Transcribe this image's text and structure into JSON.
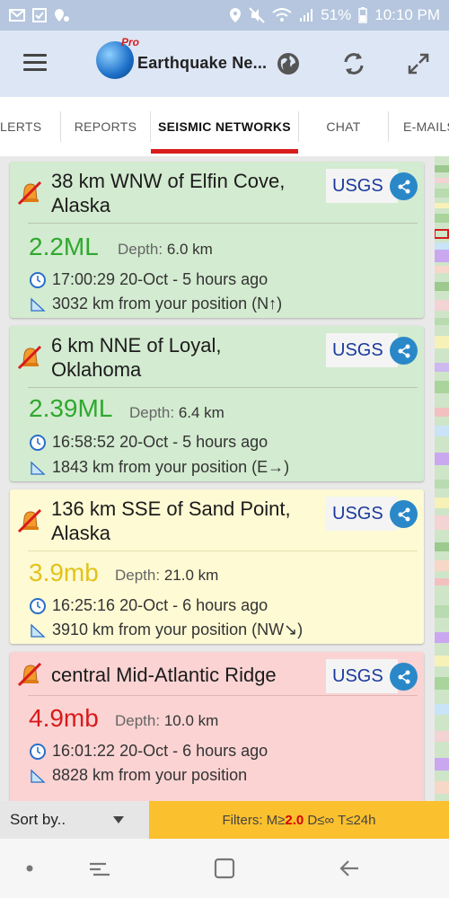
{
  "status_bar": {
    "battery": "51%",
    "time": "10:10 PM"
  },
  "app_bar": {
    "title": "Earthquake Ne...",
    "logo_badge": "Pro"
  },
  "tabs": [
    {
      "label": "LERTS",
      "active": false
    },
    {
      "label": "REPORTS",
      "active": false
    },
    {
      "label": "SEISMIC NETWORKS",
      "active": true
    },
    {
      "label": "CHAT",
      "active": false
    },
    {
      "label": "E-MAILS",
      "active": false
    }
  ],
  "quakes": [
    {
      "place_line1": "38 km WNW of Elfin Cove,",
      "place_line2": "Alaska",
      "network": "USGS",
      "magnitude": "2.2ML",
      "depth_label": "Depth:",
      "depth_value": "6.0 km",
      "time": "17:00:29 20-Oct - 5 hours ago",
      "distance": "3032 km from your position (N↑)",
      "color": "#2fa82f"
    },
    {
      "place_line1": "6 km NNE of Loyal,",
      "place_line2": "Oklahoma",
      "network": "USGS",
      "magnitude": "2.39ML",
      "depth_label": "Depth:",
      "depth_value": "6.4 km",
      "time": "16:58:52 20-Oct - 5 hours ago",
      "distance": "1843 km from your position (E→)",
      "color": "#2fa82f"
    },
    {
      "place_line1": "136 km SSE of Sand Point,",
      "place_line2": "Alaska",
      "network": "USGS",
      "magnitude": "3.9mb",
      "depth_label": "Depth:",
      "depth_value": "21.0 km",
      "time": "16:25:16 20-Oct - 6 hours ago",
      "distance": "3910 km from your position (NW↘)",
      "color": "#e3c21c"
    },
    {
      "place_line1": "central Mid-Atlantic Ridge",
      "place_line2": "",
      "network": "USGS",
      "magnitude": "4.9mb",
      "depth_label": "Depth:",
      "depth_value": "10.0 km",
      "time": "16:01:22 20-Oct - 6 hours ago",
      "distance": "8828 km from your position",
      "color": "#d81b1b"
    }
  ],
  "bottom_bar": {
    "sort_label": "Sort by..",
    "filters_prefix": "Filters: M≥",
    "filters_mag": "2.0",
    "filters_suffix": " D≤∞ T≤24h"
  },
  "colors": {
    "active_tab_underline": "#d81b1b",
    "filters_bg": "#fbc02d",
    "network_text": "#1a3a9c",
    "share_bg": "#2a88c8"
  }
}
